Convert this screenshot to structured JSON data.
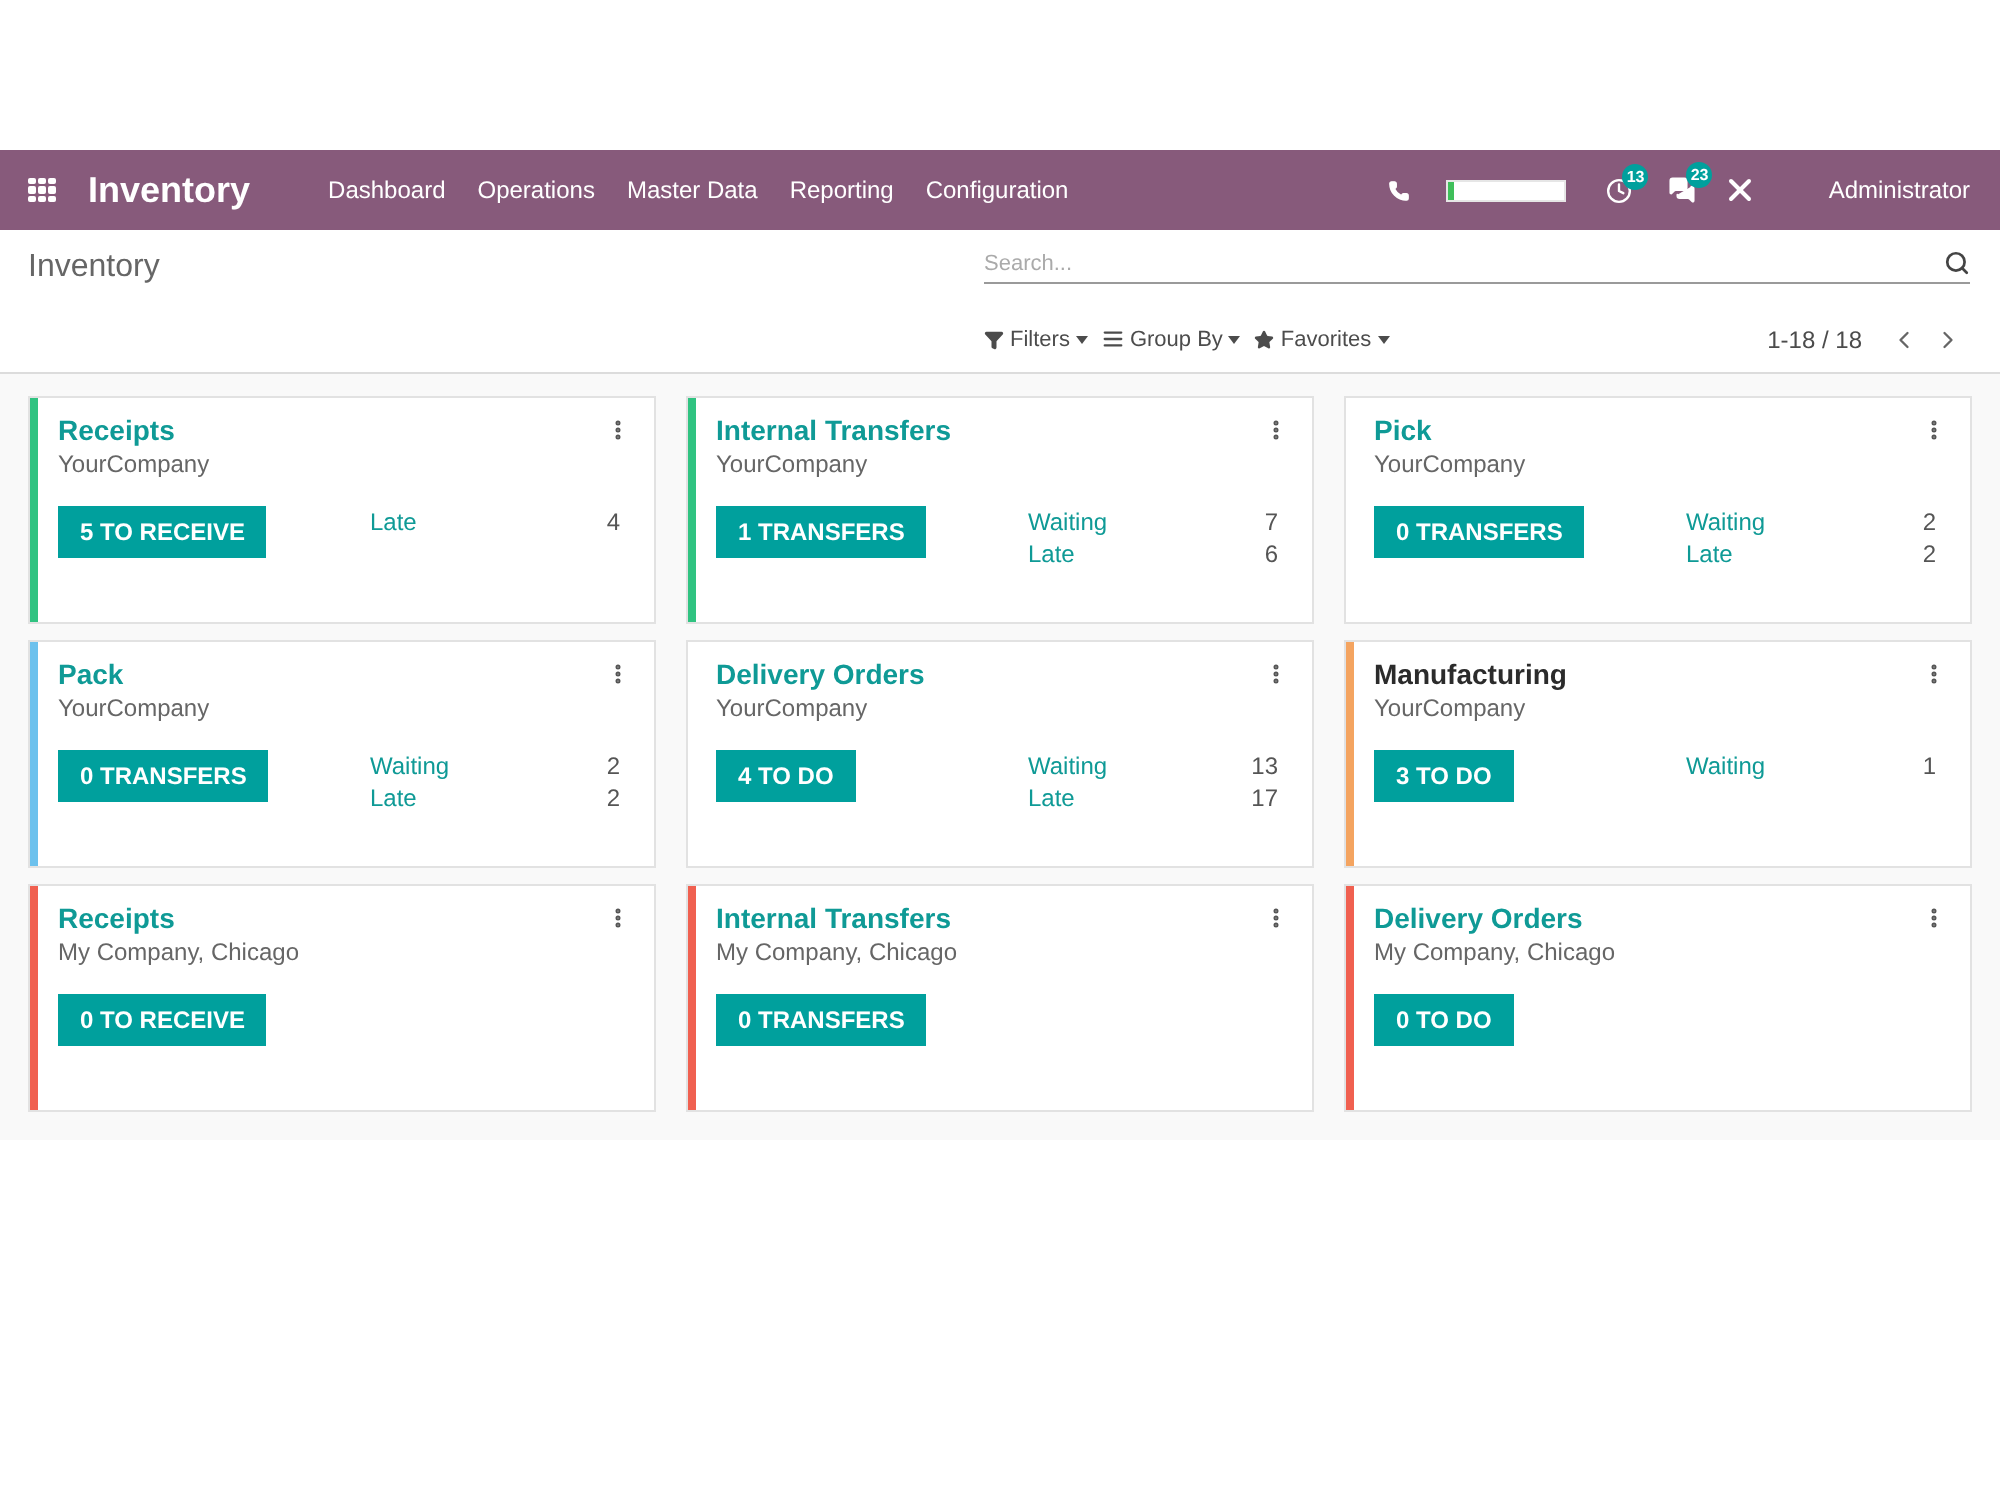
{
  "navbar": {
    "app_title": "Inventory",
    "menu": [
      "Dashboard",
      "Operations",
      "Master Data",
      "Reporting",
      "Configuration"
    ],
    "progress": {
      "level": 0.05
    },
    "activity_count": "13",
    "messages_count": "23",
    "user": "Administrator"
  },
  "control_panel": {
    "breadcrumb": "Inventory",
    "search": {
      "placeholder": "Search..."
    },
    "filters": [
      {
        "kind": "filter",
        "label": "Filters"
      },
      {
        "kind": "group",
        "label": "Group By"
      },
      {
        "kind": "favorite",
        "label": "Favorites"
      }
    ],
    "pager": "1-18 / 18"
  },
  "cards": [
    {
      "title": "Receipts",
      "linked": true,
      "company": "YourCompany",
      "color": "#30c381",
      "action": "5 TO RECEIVE",
      "stats": [
        {
          "label": "Late",
          "value": "4"
        }
      ]
    },
    {
      "title": "Internal Transfers",
      "linked": true,
      "company": "YourCompany",
      "color": "#30c381",
      "action": "1 TRANSFERS",
      "stats": [
        {
          "label": "Waiting",
          "value": "7"
        },
        {
          "label": "Late",
          "value": "6"
        }
      ]
    },
    {
      "title": "Pick",
      "linked": true,
      "company": "YourCompany",
      "action": "0 TRANSFERS",
      "stats": [
        {
          "label": "Waiting",
          "value": "2"
        },
        {
          "label": "Late",
          "value": "2"
        }
      ]
    },
    {
      "title": "Pack",
      "linked": true,
      "company": "YourCompany",
      "color": "#6cc1ed",
      "action": "0 TRANSFERS",
      "stats": [
        {
          "label": "Waiting",
          "value": "2"
        },
        {
          "label": "Late",
          "value": "2"
        }
      ]
    },
    {
      "title": "Delivery Orders",
      "linked": true,
      "company": "YourCompany",
      "action": "4 TO DO",
      "stats": [
        {
          "label": "Waiting",
          "value": "13"
        },
        {
          "label": "Late",
          "value": "17"
        }
      ]
    },
    {
      "title": "Manufacturing",
      "linked": false,
      "company": "YourCompany",
      "color": "#f4a460",
      "action": "3 TO DO",
      "stats": [
        {
          "label": "Waiting",
          "value": "1"
        }
      ]
    },
    {
      "title": "Receipts",
      "linked": true,
      "company": "My Company, Chicago",
      "color": "#f06050",
      "action": "0 TO RECEIVE"
    },
    {
      "title": "Internal Transfers",
      "linked": true,
      "company": "My Company, Chicago",
      "color": "#f06050",
      "action": "0 TRANSFERS"
    },
    {
      "title": "Delivery Orders",
      "linked": true,
      "company": "My Company, Chicago",
      "color": "#f06050",
      "action": "0 TO DO"
    }
  ]
}
